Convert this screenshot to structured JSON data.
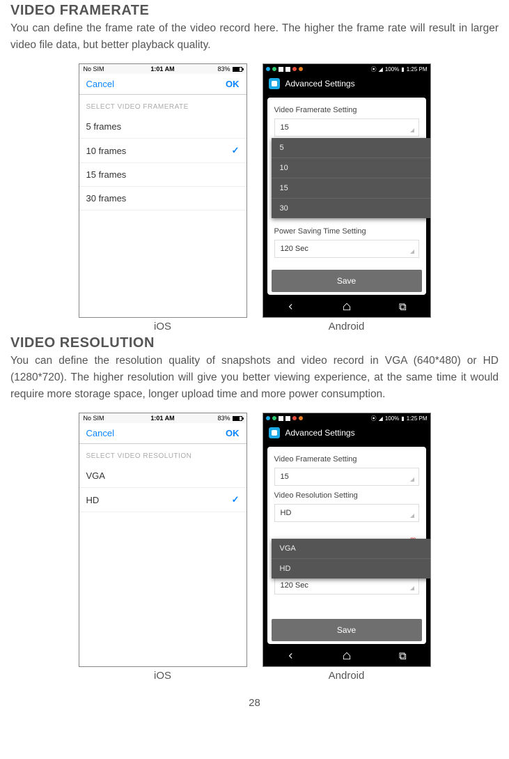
{
  "page_number": "28",
  "section1": {
    "heading": "VIDEO FRAMERATE",
    "body": "You can define the frame rate of the video record here.  The higher the frame rate will result in larger video file data, but better playback quality."
  },
  "section2": {
    "heading": "VIDEO RESOLUTION",
    "body": "You can define the resolution quality of snapshots and video record in VGA (640*480) or HD (1280*720).  The higher resolution will give you better viewing experience, at the same time it would require more storage space, longer upload time and more power consumption."
  },
  "captions": {
    "ios": "iOS",
    "android": "Android"
  },
  "ios": {
    "status_left": "No SIM",
    "status_time": "1:01 AM",
    "status_batt": "83%",
    "cancel": "Cancel",
    "ok": "OK",
    "head_framerate": "SELECT VIDEO FRAMERATE",
    "framerate_items": [
      "5 frames",
      "10 frames",
      "15 frames",
      "30 frames"
    ],
    "framerate_selected_index": 1,
    "head_resolution": "SELECT VIDEO RESOLUTION",
    "resolution_items": [
      "VGA",
      "HD"
    ],
    "resolution_selected_index": 1
  },
  "android": {
    "status_batt": "100%",
    "status_time": "1:25 PM",
    "appbar_title": "Advanced Settings",
    "label_framerate": "Video Framerate Setting",
    "value_framerate": "15",
    "dropdown_framerate": [
      "5",
      "10",
      "15",
      "30"
    ],
    "label_resolution": "Video Resolution Setting",
    "value_resolution": "HD",
    "dropdown_resolution": [
      "VGA",
      "HD"
    ],
    "red_text": "m",
    "label_powersave": "Power Saving Time Setting",
    "value_powersave": "120 Sec",
    "save": "Save"
  }
}
